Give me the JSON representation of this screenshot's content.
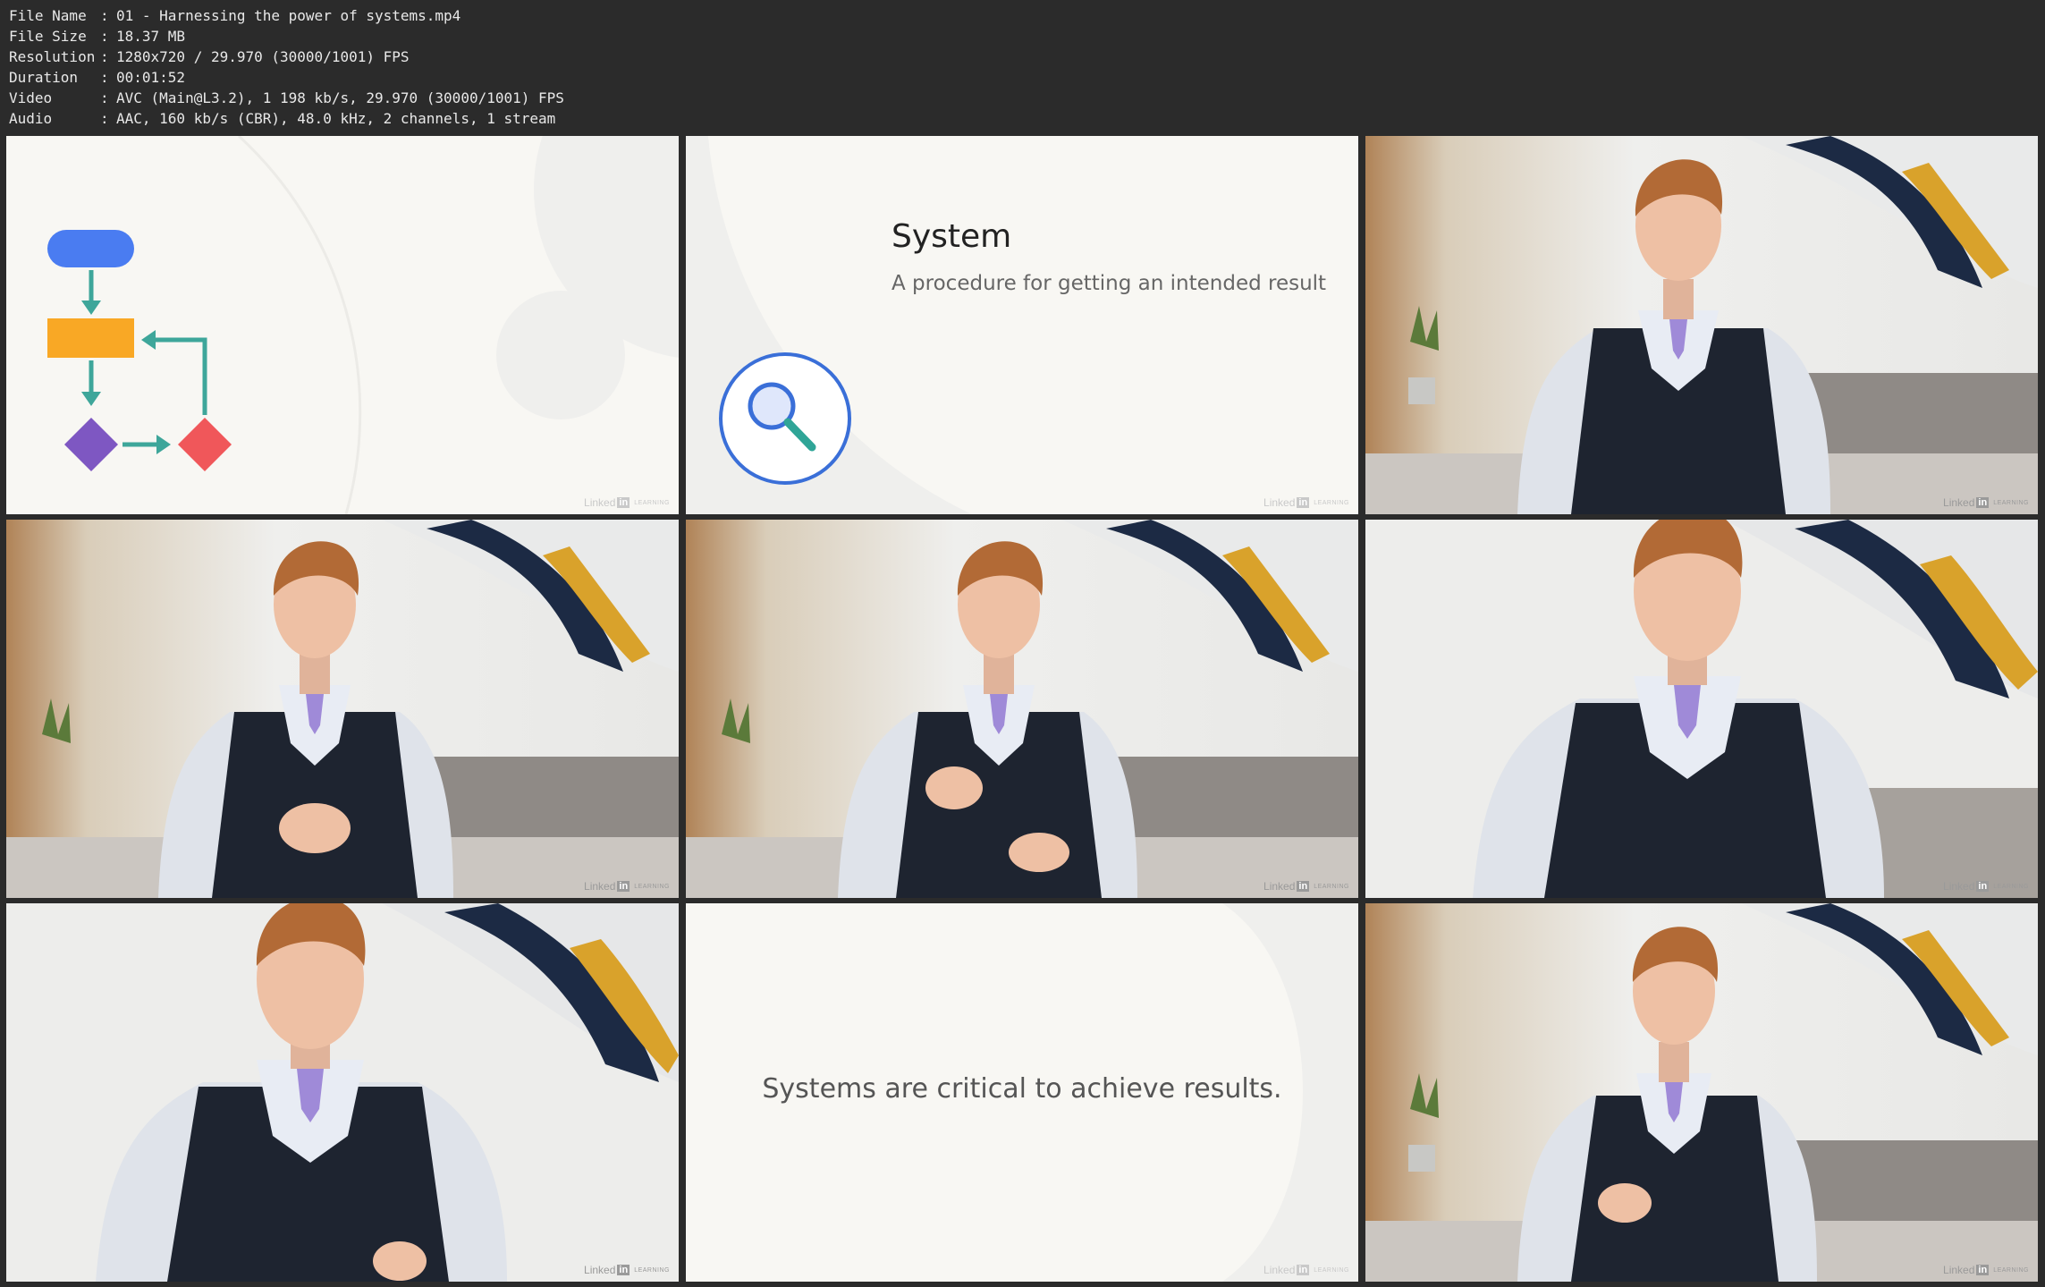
{
  "info": [
    {
      "key": "File Name",
      "sep": ":",
      "value": "01 - Harnessing the power of systems.mp4"
    },
    {
      "key": "File Size",
      "sep": ":",
      "value": "18.37 MB"
    },
    {
      "key": "Resolution",
      "sep": ":",
      "value": "1280x720 / 29.970 (30000/1001) FPS"
    },
    {
      "key": "Duration",
      "sep": ":",
      "value": "00:01:52"
    },
    {
      "key": "Video",
      "sep": ":",
      "value": "AVC (Main@L3.2), 1 198 kb/s, 29.970 (30000/1001) FPS"
    },
    {
      "key": "Audio",
      "sep": ":",
      "value": "AAC, 160 kb/s (CBR), 48.0 kHz, 2 channels, 1 stream"
    }
  ],
  "slides": {
    "system_title": "System",
    "system_subtitle": "A procedure for getting an intended result",
    "quote": "Systems are critical to achieve results."
  },
  "watermark": {
    "brand": "Linked",
    "in": "in",
    "suffix": "LEARNING"
  },
  "colors": {
    "flow_start": "#4a7cf1",
    "flow_process": "#f9a825",
    "flow_decision_a": "#7e57c2",
    "flow_decision_b": "#f0575a",
    "flow_arrow": "#3ea69a",
    "magnifier_ring": "#3a6fd8",
    "magnifier_handle": "#2fa597"
  }
}
